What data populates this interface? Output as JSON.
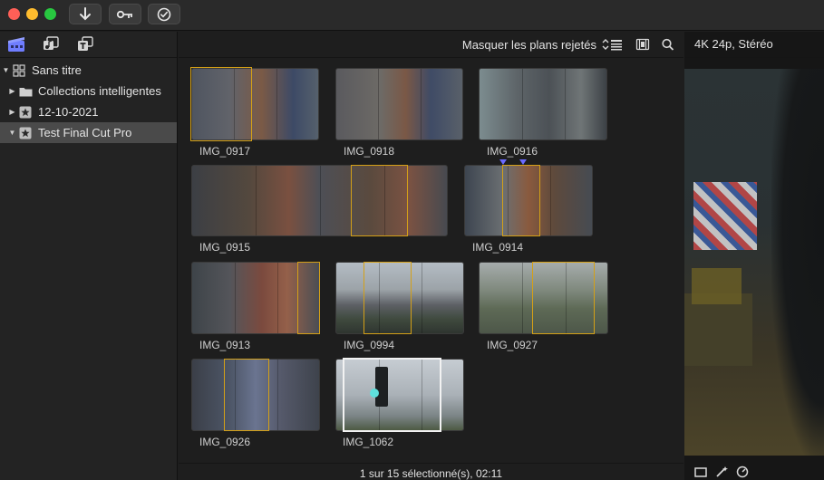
{
  "titlebar": {
    "buttons": [
      "import-icon",
      "keywords-icon",
      "background-tasks-icon"
    ]
  },
  "sidebar": {
    "toolbar": [
      "libraries-icon",
      "photos-audio-icon",
      "titles-generators-icon"
    ],
    "items": [
      {
        "label": "Sans titre",
        "expanded": true,
        "icon": "library-icon",
        "indent": 0
      },
      {
        "label": "Collections intelligentes",
        "expanded": false,
        "icon": "folder-icon",
        "indent": 1
      },
      {
        "label": "12-10-2021",
        "expanded": false,
        "icon": "event-star-icon",
        "indent": 1
      },
      {
        "label": "Test Final Cut Pro",
        "expanded": true,
        "icon": "event-star-icon",
        "indent": 1,
        "selected": true
      }
    ]
  },
  "browser": {
    "filter_label": "Masquer les plans rejetés",
    "clips": [
      {
        "name": "IMG_0917"
      },
      {
        "name": "IMG_0918"
      },
      {
        "name": "IMG_0916"
      },
      {
        "name": "IMG_0915"
      },
      {
        "name": "IMG_0914"
      },
      {
        "name": "IMG_0913"
      },
      {
        "name": "IMG_0994"
      },
      {
        "name": "IMG_0927"
      },
      {
        "name": "IMG_0926"
      },
      {
        "name": "IMG_1062"
      }
    ],
    "status": "1 sur 15 sélectionné(s), 02:11"
  },
  "viewer": {
    "format_label": "4K 24p, Stéréo"
  },
  "colors": {
    "accent_selection": "#d4a017",
    "marker": "#6a6aff",
    "selected_row": "#4a4a4a"
  }
}
